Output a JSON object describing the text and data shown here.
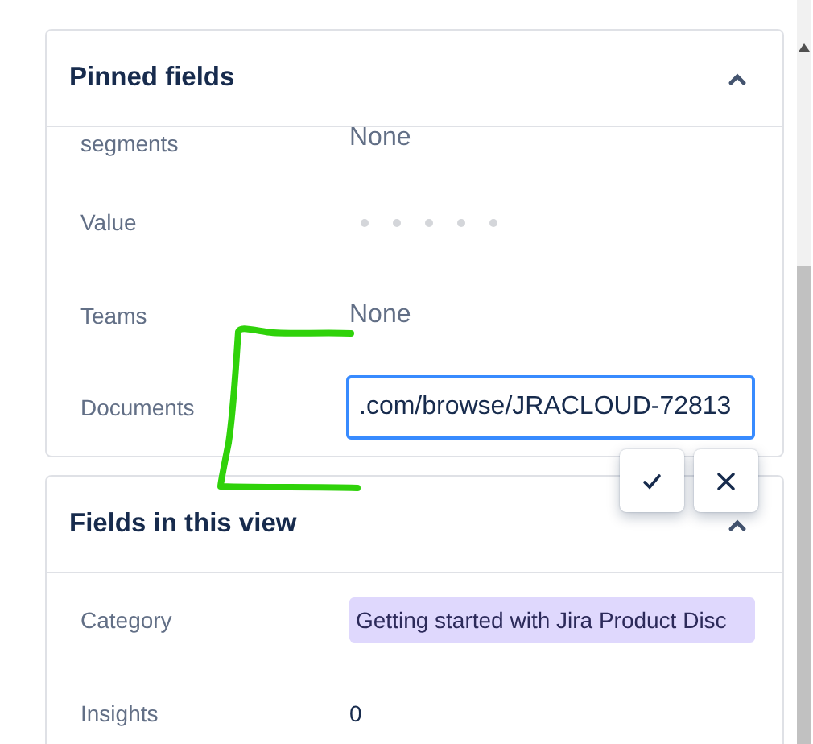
{
  "panels": [
    {
      "title": "Pinned fields",
      "expanded": true,
      "fields": [
        {
          "label": "segments",
          "kind": "empty",
          "value": "None"
        },
        {
          "label": "Value",
          "kind": "loading"
        },
        {
          "label": "Teams",
          "kind": "empty",
          "value": "None"
        },
        {
          "label": "Documents",
          "kind": "input",
          "value": ".com/browse/JRACLOUD-72813",
          "focused": true
        }
      ]
    },
    {
      "title": "Fields in this view",
      "expanded": true,
      "fields": [
        {
          "label": "Category",
          "kind": "tag",
          "value": "Getting started with Jira Product Disc",
          "color": "#dfd8fd"
        },
        {
          "label": "Insights",
          "kind": "number",
          "value": "0"
        }
      ]
    }
  ]
}
